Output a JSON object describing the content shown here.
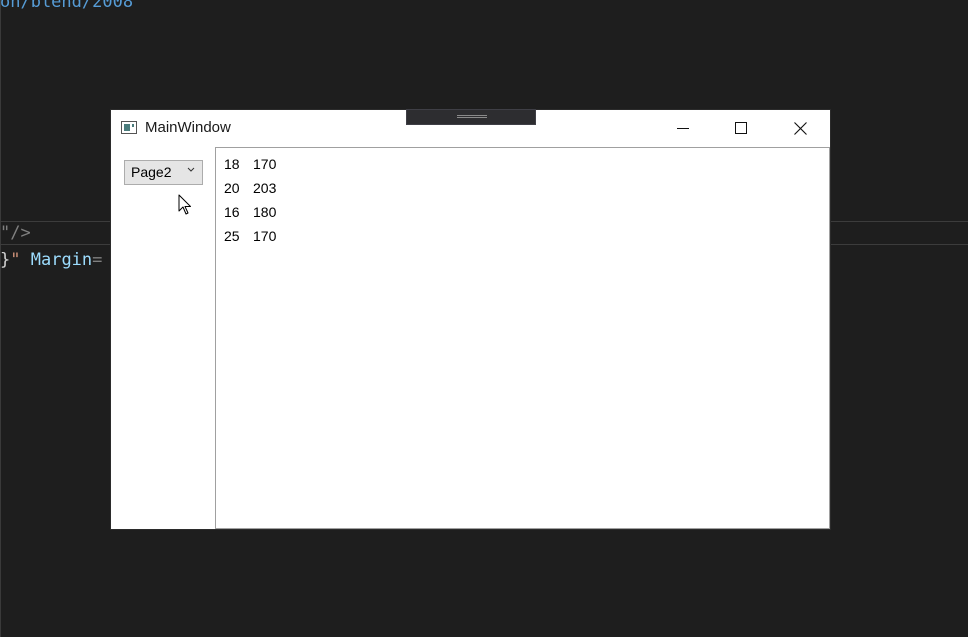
{
  "editor": {
    "line1": "on/blend/2008",
    "line2": "\"/>",
    "line3_brace": "}",
    "line3_quote": "\"",
    "line3_attr": " Margin",
    "line3_eq": "="
  },
  "window": {
    "title": "MainWindow",
    "controls": {
      "minimize": "minimize",
      "maximize": "maximize",
      "close": "close"
    }
  },
  "page_selector": {
    "selected": "Page2"
  },
  "rows": [
    {
      "age": "18",
      "height": "170"
    },
    {
      "age": "20",
      "height": "203"
    },
    {
      "age": "16",
      "height": "180"
    },
    {
      "age": "25",
      "height": "170"
    }
  ],
  "colors": {
    "editor_bg": "#1e1e1e",
    "keyword_blue": "#569cd6",
    "attr_blue": "#9cdcfe",
    "window_bg": "#ffffff"
  }
}
